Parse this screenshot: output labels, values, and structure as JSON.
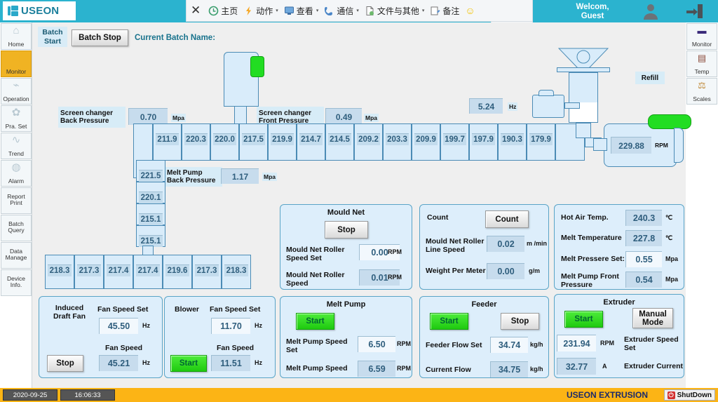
{
  "brand": {
    "name": "USEON",
    "accent": "#2bb3cf"
  },
  "ribbon": {
    "close": "✕",
    "items": [
      {
        "label": "主页",
        "icon": "home-circle-icon",
        "caret": ""
      },
      {
        "label": "动作",
        "icon": "lightning-icon",
        "caret": "▾"
      },
      {
        "label": "查看",
        "icon": "monitor-icon",
        "caret": "▾"
      },
      {
        "label": "通信",
        "icon": "phone-icon",
        "caret": "▾"
      },
      {
        "label": "文件与其他",
        "icon": "file-icon",
        "caret": "▾"
      },
      {
        "label": "备注",
        "icon": "note-pencil-icon",
        "caret": ""
      }
    ],
    "smiley": "☺"
  },
  "header": {
    "welcome_line1": "Welcom,",
    "welcome_line2": "Guest"
  },
  "sidebar_left": {
    "items": [
      {
        "label": "Home",
        "glyph": "⌂",
        "active": false
      },
      {
        "label": "Monitor",
        "glyph": "▣",
        "active": true
      },
      {
        "label": "Operation",
        "glyph": "⌁",
        "active": false
      },
      {
        "label": "Pra. Set",
        "glyph": "✿",
        "active": false
      },
      {
        "label": "Trend",
        "glyph": "∿",
        "active": false
      },
      {
        "label": "Alarm",
        "glyph": "◍",
        "active": false
      },
      {
        "label": "Report Print",
        "glyph": "",
        "active": false
      },
      {
        "label": "Batch Query",
        "glyph": "",
        "active": false
      },
      {
        "label": "Data Manage",
        "glyph": "",
        "active": false
      },
      {
        "label": "Device Info.",
        "glyph": "",
        "active": false
      }
    ]
  },
  "sidebar_right": {
    "items": [
      {
        "label": "Monitor",
        "glyph": "▬"
      },
      {
        "label": "Temp",
        "glyph": "▤"
      },
      {
        "label": "Scales",
        "glyph": "⚖"
      }
    ]
  },
  "batch": {
    "start_label": "Batch Start",
    "stop_label": "Batch Stop",
    "current_batch_label": "Current Batch Name:"
  },
  "screen_changer": {
    "back_label": "Screen changer Back Pressure",
    "back_value": "0.70",
    "back_unit": "Mpa",
    "front_label": "Screen changer Front Pressure",
    "front_value": "0.49",
    "front_unit": "Mpa"
  },
  "melt_pump_back": {
    "label": "Melt Pump Back Pressure",
    "value": "1.17",
    "unit": "Mpa"
  },
  "barrel_zones": [
    "211.9",
    "220.3",
    "220.0",
    "217.5",
    "219.9",
    "214.7",
    "214.5",
    "209.2",
    "203.3",
    "209.9",
    "199.7",
    "197.9",
    "190.3",
    "179.9"
  ],
  "vertical_zones": [
    "221.5",
    "220.1",
    "215.1",
    "215.1"
  ],
  "bottom_zones": [
    "218.3",
    "217.3",
    "217.4",
    "217.4",
    "219.6",
    "217.3",
    "218.3"
  ],
  "feeder_motor": {
    "value": "5.24",
    "unit": "Hz"
  },
  "refill_label": "Refill",
  "screw_speed": {
    "value": "229.88",
    "unit": "RPM"
  },
  "mould_net_panel": {
    "title": "Mould Net",
    "button": "Stop",
    "rows": [
      {
        "label": "Mould Net Roller Speed Set",
        "value": "0.00",
        "unit": "RPM",
        "readonly": false
      },
      {
        "label": "Mould Net Roller Speed",
        "value": "0.01",
        "unit": "RPM",
        "readonly": true
      }
    ]
  },
  "count_panel": {
    "label": "Count",
    "button": "Count",
    "rows": [
      {
        "label": "Mould Net Roller Line Speed",
        "value": "0.02",
        "unit": "m /min"
      },
      {
        "label": "Weight Per Meter",
        "value": "0.00",
        "unit": "g/m"
      }
    ]
  },
  "temp_panel": {
    "rows": [
      {
        "label": "Hot Air Temp.",
        "value": "240.3",
        "unit": "℃",
        "readonly": true
      },
      {
        "label": "Melt Temperature",
        "value": "227.8",
        "unit": "℃",
        "readonly": true
      },
      {
        "label": "Melt Pressere Set:",
        "value": "0.55",
        "unit": "Mpa",
        "readonly": false
      },
      {
        "label": "Melt Pump Front Pressure",
        "value": "0.54",
        "unit": "Mpa",
        "readonly": true
      }
    ]
  },
  "induced_draft_fan": {
    "title": "Induced Draft Fan",
    "button": "Stop",
    "button_state": "stop",
    "set_label": "Fan Speed Set",
    "set_value": "45.50",
    "set_unit": "Hz",
    "actual_label": "Fan Speed",
    "actual_value": "45.21",
    "actual_unit": "Hz"
  },
  "blower": {
    "title": "Blower",
    "button": "Start",
    "button_state": "start",
    "set_label": "Fan Speed Set",
    "set_value": "11.70",
    "set_unit": "Hz",
    "actual_label": "Fan Speed",
    "actual_value": "11.51",
    "actual_unit": "Hz"
  },
  "melt_pump": {
    "title": "Melt Pump",
    "button": "Start",
    "set_label": "Melt Pump Speed Set",
    "set_value": "6.50",
    "set_unit": "RPM",
    "actual_label": "Melt Pump Speed",
    "actual_value": "6.59",
    "actual_unit": "RPM"
  },
  "feeder": {
    "title": "Feeder",
    "start_button": "Start",
    "stop_button": "Stop",
    "set_label": "Feeder Flow Set",
    "set_value": "34.74",
    "set_unit": "kg/h",
    "actual_label": "Current Flow",
    "actual_value": "34.75",
    "actual_unit": "kg/h"
  },
  "extruder": {
    "title": "Extruder",
    "start_button": "Start",
    "mode_button": "Manual Mode",
    "speed_value": "231.94",
    "speed_unit": "RPM",
    "speed_label": "Extruder Speed Set",
    "current_value": "32.77",
    "current_unit": "A",
    "current_label": "Extruder Current"
  },
  "statusbar": {
    "date": "2020-09-25",
    "time": "16:06:33",
    "brand": "USEON EXTRUSION",
    "shutdown": "ShutDown",
    "power_icon": "⏻"
  }
}
